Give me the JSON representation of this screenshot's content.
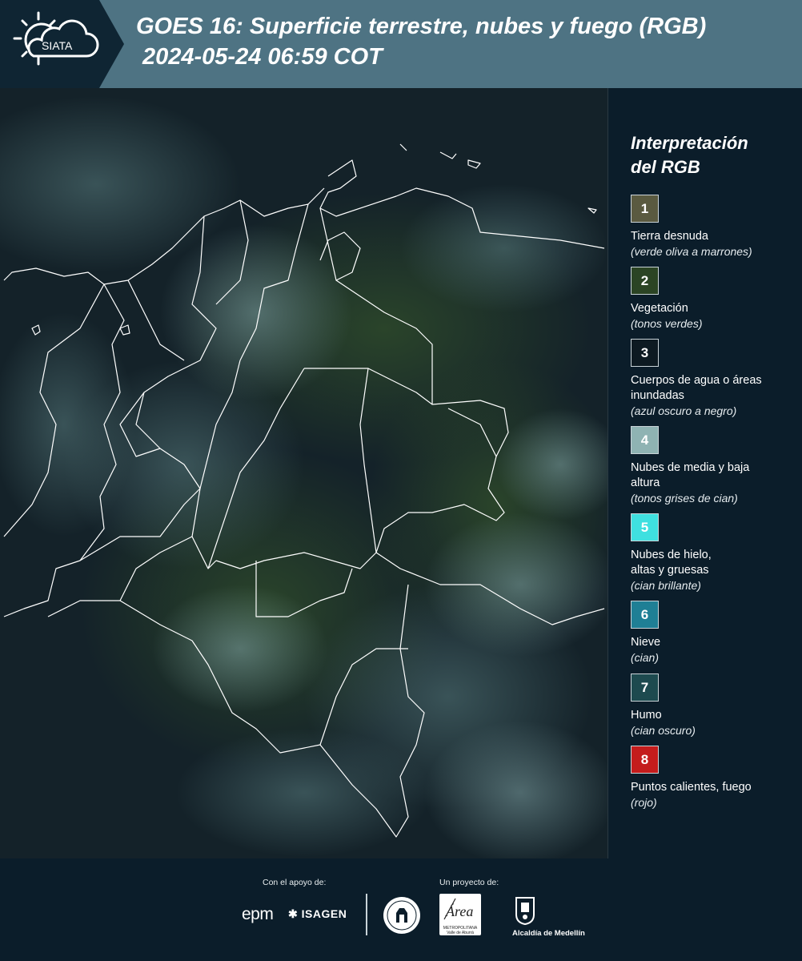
{
  "header": {
    "logo_text": "SIATA",
    "title": "GOES 16: Superficie terrestre, nubes y fuego (RGB)",
    "subtitle": "2024-05-24 06:59 COT"
  },
  "legend": {
    "title_line1": "Interpretación",
    "title_line2": "del RGB",
    "items": [
      {
        "number": "1",
        "color": "#5a5a40",
        "label": "Tierra desnuda",
        "note": "(verde oliva a marrones)"
      },
      {
        "number": "2",
        "color": "#2b4424",
        "label": "Vegetación",
        "note": "(tonos verdes)"
      },
      {
        "number": "3",
        "color": "#0d1a22",
        "label": "Cuerpos de agua o áreas inundadas",
        "note": "(azul oscuro a negro)"
      },
      {
        "number": "4",
        "color": "#8fb3b3",
        "label": "Nubes de media y baja altura",
        "note": "(tonos grises de cian)"
      },
      {
        "number": "5",
        "color": "#3fe0e0",
        "label": "Nubes de hielo, altas y gruesas",
        "note": "(cian brillante)"
      },
      {
        "number": "6",
        "color": "#1f7f95",
        "label": "Nieve",
        "note": "(cian)"
      },
      {
        "number": "7",
        "color": "#1d4a4f",
        "label": "Humo",
        "note": "(cian oscuro)"
      },
      {
        "number": "8",
        "color": "#c41c1c",
        "label": "Puntos calientes, fuego",
        "note": "(rojo)"
      }
    ]
  },
  "footer": {
    "support_label": "Con el apoyo de:",
    "project_label": "Un proyecto de:",
    "epm": "epm",
    "isagen": "ISAGEN",
    "area_name": "METROPOLITANA",
    "area_sub": "Valle de Aburrá",
    "alcaldia": "Alcaldía de Medellín"
  }
}
